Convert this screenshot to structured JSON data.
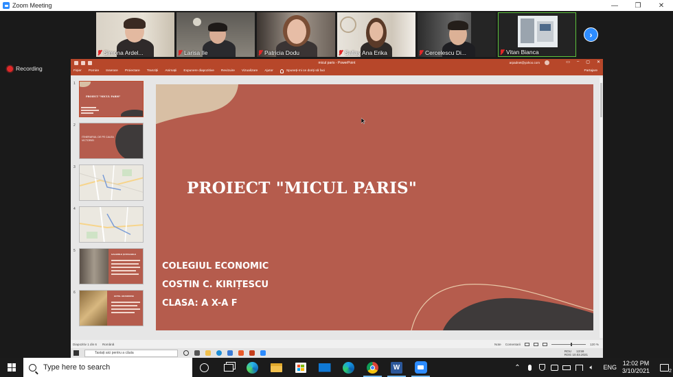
{
  "zoom": {
    "window_title": "Zoom Meeting",
    "minimize": "—",
    "restore": "❐",
    "close": "✕",
    "recording_label": "Recording",
    "next_page": "›"
  },
  "participants": [
    {
      "name": "Simona Ardel..."
    },
    {
      "name": "Larisa Ile"
    },
    {
      "name": "Patricia Dodu"
    },
    {
      "name": "Sallay Ana Erika"
    },
    {
      "name": "Cercelescu Di..."
    },
    {
      "name": "Vitan Bianca"
    }
  ],
  "powerpoint": {
    "title": "micul paris  -  PowerPoint",
    "account_email": "arpadnet@yahoo.com",
    "share": "Partajare",
    "ribbon_tabs": [
      "Fișier",
      "Pornire",
      "Inserare",
      "Proiectare",
      "Tranziții",
      "Animații",
      "Expunere diapozitive",
      "Revizuire",
      "Vizualizare",
      "Ajutor",
      "Spuneți-mi ce doriți să faci"
    ],
    "slide_numbers": [
      "1",
      "2",
      "3",
      "4",
      "5",
      "6"
    ],
    "thumb2_text": "ITINERARIUL DE PE CALEA VICTORIEI",
    "thumb5_heading": "GALERIILE ȘI PASAJELE",
    "thumb6_heading": "HOTEL GRANDIOSE",
    "slide": {
      "title": "PROIECT \"MICUL PARIS\"",
      "lines": [
        "COLEGIUL ECONOMIC",
        "COSTIN C. KIRIȚESCU",
        "CLASA: A X-A F"
      ]
    },
    "status": {
      "slide_count": "Diapozitiv 1 din 6",
      "language": "Română",
      "notes": "Note",
      "comments": "Comentarii",
      "zoom": "120 %"
    }
  },
  "inner_taskbar": {
    "search_placeholder": "Tastați aici pentru a căuta",
    "lang": "ROU",
    "lang2": "ROG",
    "time": "13:59",
    "date": "10.03.2021"
  },
  "taskbar": {
    "search_placeholder": "Type here to search",
    "language": "ENG",
    "time": "12:02 PM",
    "date": "3/10/2021",
    "notifications": "2",
    "tray_chevron": "⌃"
  },
  "colors": {
    "slide_bg": "#b55c4d",
    "ppt_accent": "#b7472a",
    "zoom_blue": "#2d8cff",
    "muted_red": "#e02828"
  }
}
